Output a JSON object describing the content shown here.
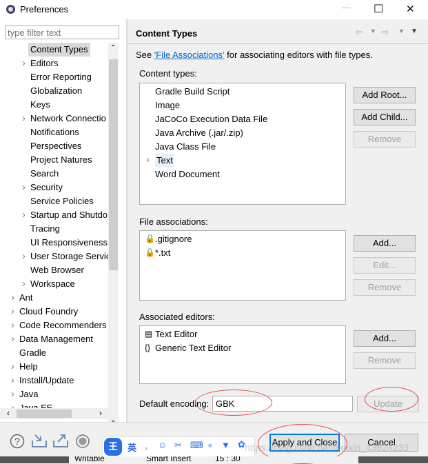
{
  "window": {
    "title": "Preferences",
    "minimize": "—",
    "maximize": "☐",
    "close": "✕"
  },
  "filter": {
    "placeholder": "type filter text"
  },
  "tree": [
    {
      "label": "Content Types",
      "level": 1,
      "expandable": false,
      "selected": true
    },
    {
      "label": "Editors",
      "level": 1,
      "expandable": true
    },
    {
      "label": "Error Reporting",
      "level": 1,
      "expandable": false
    },
    {
      "label": "Globalization",
      "level": 1,
      "expandable": false
    },
    {
      "label": "Keys",
      "level": 1,
      "expandable": false
    },
    {
      "label": "Network Connectio",
      "level": 1,
      "expandable": true
    },
    {
      "label": "Notifications",
      "level": 1,
      "expandable": false
    },
    {
      "label": "Perspectives",
      "level": 1,
      "expandable": false
    },
    {
      "label": "Project Natures",
      "level": 1,
      "expandable": false
    },
    {
      "label": "Search",
      "level": 1,
      "expandable": false
    },
    {
      "label": "Security",
      "level": 1,
      "expandable": true
    },
    {
      "label": "Service Policies",
      "level": 1,
      "expandable": false
    },
    {
      "label": "Startup and Shutdo",
      "level": 1,
      "expandable": true
    },
    {
      "label": "Tracing",
      "level": 1,
      "expandable": false
    },
    {
      "label": "UI Responsiveness",
      "level": 1,
      "expandable": false
    },
    {
      "label": "User Storage Servic",
      "level": 1,
      "expandable": true
    },
    {
      "label": "Web Browser",
      "level": 1,
      "expandable": false
    },
    {
      "label": "Workspace",
      "level": 1,
      "expandable": true
    },
    {
      "label": "Ant",
      "level": 0,
      "expandable": true
    },
    {
      "label": "Cloud Foundry",
      "level": 0,
      "expandable": true
    },
    {
      "label": "Code Recommenders",
      "level": 0,
      "expandable": true
    },
    {
      "label": "Data Management",
      "level": 0,
      "expandable": true
    },
    {
      "label": "Gradle",
      "level": 0,
      "expandable": false
    },
    {
      "label": "Help",
      "level": 0,
      "expandable": true
    },
    {
      "label": "Install/Update",
      "level": 0,
      "expandable": true
    },
    {
      "label": "Java",
      "level": 0,
      "expandable": true
    },
    {
      "label": "Java EE",
      "level": 0,
      "expandable": true
    }
  ],
  "page": {
    "title": "Content Types",
    "desc_prefix": "See ",
    "desc_link": "'File Associations'",
    "desc_suffix": " for associating editors with file types.",
    "content_types_label": "Content types:",
    "content_types": [
      {
        "label": "Gradle Build Script"
      },
      {
        "label": "Image"
      },
      {
        "label": "JaCoCo Execution Data File"
      },
      {
        "label": "Java Archive (.jar/.zip)"
      },
      {
        "label": "Java Class File"
      },
      {
        "label": "Text",
        "expandable": true,
        "selected": true
      },
      {
        "label": "Word Document"
      }
    ],
    "ct_buttons": {
      "add_root": "Add Root...",
      "add_child": "Add Child...",
      "remove": "Remove"
    },
    "file_assoc_label": "File associations:",
    "file_assocs": [
      {
        "label": ".gitignore",
        "icon": "lock-icon"
      },
      {
        "label": "*.txt",
        "icon": "lock-icon"
      }
    ],
    "fa_buttons": {
      "add": "Add...",
      "edit": "Edit...",
      "remove": "Remove"
    },
    "editors_label": "Associated editors:",
    "editors": [
      {
        "label": "Text Editor",
        "icon": "text-file-icon"
      },
      {
        "label": "Generic Text Editor",
        "icon": "generic-editor-icon"
      }
    ],
    "ed_buttons": {
      "add": "Add...",
      "remove": "Remove"
    },
    "encoding_label": "Default encoding:",
    "encoding_value": "GBK",
    "update": "Update"
  },
  "footer": {
    "apply_close": "Apply and Close",
    "cancel": "Cancel"
  },
  "ime": {
    "logo": "王",
    "lang": "英",
    "punct": "，"
  },
  "watermark": "https://blog.csdn.net/weixin_43824233",
  "statusbar": {
    "writable": "Writable",
    "insert": "Smart Insert",
    "pos": "15 : 30"
  },
  "colors": {
    "accent": "#0078d7",
    "link": "#0066cc",
    "annotation": "#e8484f"
  }
}
